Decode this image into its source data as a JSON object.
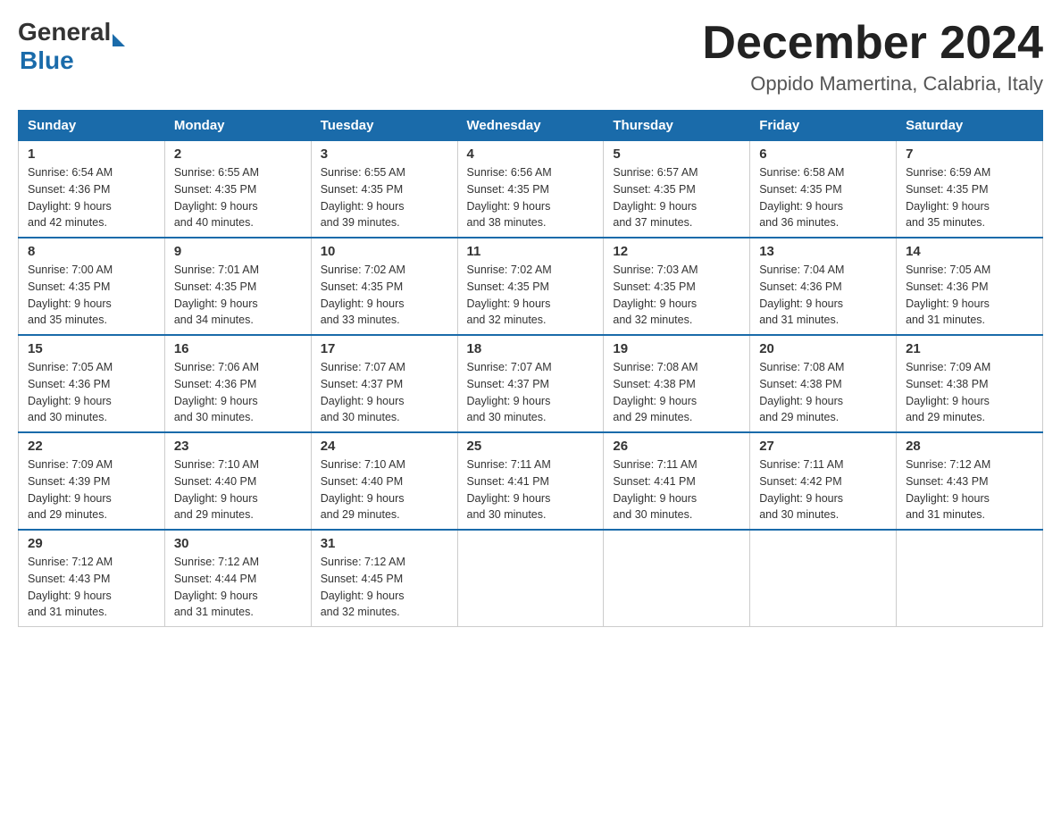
{
  "header": {
    "logo_general": "General",
    "logo_blue": "Blue",
    "month_title": "December 2024",
    "subtitle": "Oppido Mamertina, Calabria, Italy"
  },
  "days_of_week": [
    "Sunday",
    "Monday",
    "Tuesday",
    "Wednesday",
    "Thursday",
    "Friday",
    "Saturday"
  ],
  "weeks": [
    [
      {
        "date": "1",
        "sunrise": "6:54 AM",
        "sunset": "4:36 PM",
        "daylight": "9 hours and 42 minutes."
      },
      {
        "date": "2",
        "sunrise": "6:55 AM",
        "sunset": "4:35 PM",
        "daylight": "9 hours and 40 minutes."
      },
      {
        "date": "3",
        "sunrise": "6:55 AM",
        "sunset": "4:35 PM",
        "daylight": "9 hours and 39 minutes."
      },
      {
        "date": "4",
        "sunrise": "6:56 AM",
        "sunset": "4:35 PM",
        "daylight": "9 hours and 38 minutes."
      },
      {
        "date": "5",
        "sunrise": "6:57 AM",
        "sunset": "4:35 PM",
        "daylight": "9 hours and 37 minutes."
      },
      {
        "date": "6",
        "sunrise": "6:58 AM",
        "sunset": "4:35 PM",
        "daylight": "9 hours and 36 minutes."
      },
      {
        "date": "7",
        "sunrise": "6:59 AM",
        "sunset": "4:35 PM",
        "daylight": "9 hours and 35 minutes."
      }
    ],
    [
      {
        "date": "8",
        "sunrise": "7:00 AM",
        "sunset": "4:35 PM",
        "daylight": "9 hours and 35 minutes."
      },
      {
        "date": "9",
        "sunrise": "7:01 AM",
        "sunset": "4:35 PM",
        "daylight": "9 hours and 34 minutes."
      },
      {
        "date": "10",
        "sunrise": "7:02 AM",
        "sunset": "4:35 PM",
        "daylight": "9 hours and 33 minutes."
      },
      {
        "date": "11",
        "sunrise": "7:02 AM",
        "sunset": "4:35 PM",
        "daylight": "9 hours and 32 minutes."
      },
      {
        "date": "12",
        "sunrise": "7:03 AM",
        "sunset": "4:35 PM",
        "daylight": "9 hours and 32 minutes."
      },
      {
        "date": "13",
        "sunrise": "7:04 AM",
        "sunset": "4:36 PM",
        "daylight": "9 hours and 31 minutes."
      },
      {
        "date": "14",
        "sunrise": "7:05 AM",
        "sunset": "4:36 PM",
        "daylight": "9 hours and 31 minutes."
      }
    ],
    [
      {
        "date": "15",
        "sunrise": "7:05 AM",
        "sunset": "4:36 PM",
        "daylight": "9 hours and 30 minutes."
      },
      {
        "date": "16",
        "sunrise": "7:06 AM",
        "sunset": "4:36 PM",
        "daylight": "9 hours and 30 minutes."
      },
      {
        "date": "17",
        "sunrise": "7:07 AM",
        "sunset": "4:37 PM",
        "daylight": "9 hours and 30 minutes."
      },
      {
        "date": "18",
        "sunrise": "7:07 AM",
        "sunset": "4:37 PM",
        "daylight": "9 hours and 30 minutes."
      },
      {
        "date": "19",
        "sunrise": "7:08 AM",
        "sunset": "4:38 PM",
        "daylight": "9 hours and 29 minutes."
      },
      {
        "date": "20",
        "sunrise": "7:08 AM",
        "sunset": "4:38 PM",
        "daylight": "9 hours and 29 minutes."
      },
      {
        "date": "21",
        "sunrise": "7:09 AM",
        "sunset": "4:38 PM",
        "daylight": "9 hours and 29 minutes."
      }
    ],
    [
      {
        "date": "22",
        "sunrise": "7:09 AM",
        "sunset": "4:39 PM",
        "daylight": "9 hours and 29 minutes."
      },
      {
        "date": "23",
        "sunrise": "7:10 AM",
        "sunset": "4:40 PM",
        "daylight": "9 hours and 29 minutes."
      },
      {
        "date": "24",
        "sunrise": "7:10 AM",
        "sunset": "4:40 PM",
        "daylight": "9 hours and 29 minutes."
      },
      {
        "date": "25",
        "sunrise": "7:11 AM",
        "sunset": "4:41 PM",
        "daylight": "9 hours and 30 minutes."
      },
      {
        "date": "26",
        "sunrise": "7:11 AM",
        "sunset": "4:41 PM",
        "daylight": "9 hours and 30 minutes."
      },
      {
        "date": "27",
        "sunrise": "7:11 AM",
        "sunset": "4:42 PM",
        "daylight": "9 hours and 30 minutes."
      },
      {
        "date": "28",
        "sunrise": "7:12 AM",
        "sunset": "4:43 PM",
        "daylight": "9 hours and 31 minutes."
      }
    ],
    [
      {
        "date": "29",
        "sunrise": "7:12 AM",
        "sunset": "4:43 PM",
        "daylight": "9 hours and 31 minutes."
      },
      {
        "date": "30",
        "sunrise": "7:12 AM",
        "sunset": "4:44 PM",
        "daylight": "9 hours and 31 minutes."
      },
      {
        "date": "31",
        "sunrise": "7:12 AM",
        "sunset": "4:45 PM",
        "daylight": "9 hours and 32 minutes."
      },
      null,
      null,
      null,
      null
    ]
  ],
  "labels": {
    "sunrise": "Sunrise:",
    "sunset": "Sunset:",
    "daylight": "Daylight:"
  }
}
